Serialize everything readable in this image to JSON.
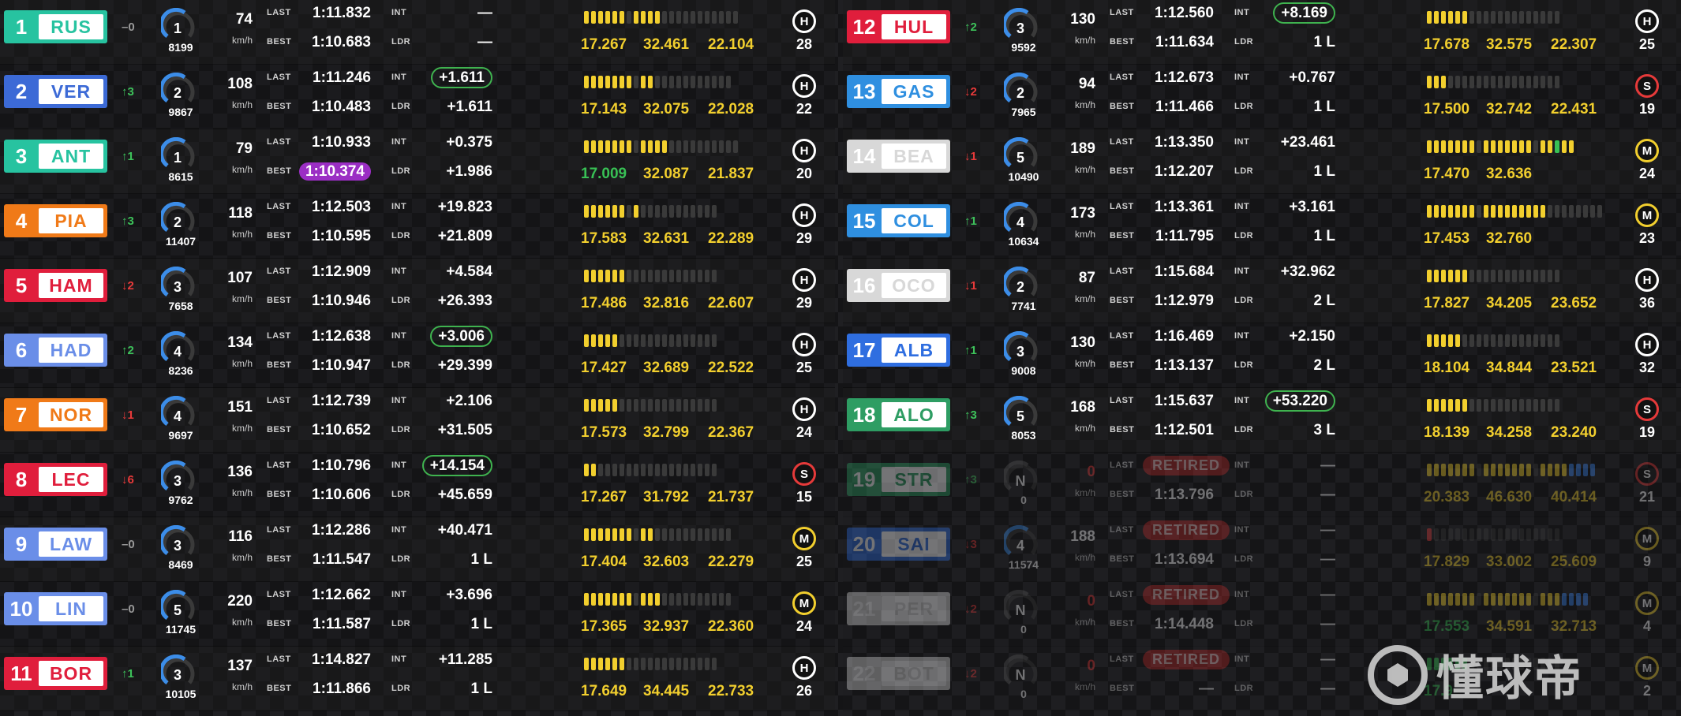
{
  "labels": {
    "last": "LAST",
    "best": "BEST",
    "int": "INT",
    "ldr": "LDR",
    "kmh": "km/h"
  },
  "watermark": "懂球帝",
  "left": [
    {
      "pos": "1",
      "code": "RUS",
      "team_color": "#27c3a0",
      "chg": "0",
      "dir": "none",
      "gear": "1",
      "rpm": "8199",
      "speed": "74",
      "last": "1:11.832",
      "best": "1:10.683",
      "best_style": "",
      "int": "—",
      "ldr": "—",
      "int_style": "",
      "s1": "17.267",
      "s2": "32.461",
      "s3": "22.104",
      "s1c": "y",
      "s2c": "y",
      "s3c": "y",
      "segs": "yyyyyy-yyyy-----------",
      "tyre": "H",
      "laps": "28",
      "dim": false
    },
    {
      "pos": "2",
      "code": "VER",
      "team_color": "#3c6ad6",
      "chg": "3",
      "dir": "up",
      "gear": "2",
      "rpm": "9867",
      "speed": "108",
      "last": "1:11.246",
      "best": "1:10.483",
      "best_style": "",
      "int": "+1.611",
      "ldr": "+1.611",
      "int_style": "green",
      "s1": "17.143",
      "s2": "32.075",
      "s3": "22.028",
      "s1c": "y",
      "s2c": "y",
      "s3c": "y",
      "segs": "yyyyyyy-yy-----------",
      "tyre": "H",
      "laps": "22",
      "dim": false
    },
    {
      "pos": "3",
      "code": "ANT",
      "team_color": "#27c3a0",
      "chg": "1",
      "dir": "up",
      "gear": "1",
      "rpm": "8615",
      "speed": "79",
      "last": "1:10.933",
      "best": "1:10.374",
      "best_style": "purple",
      "int": "+0.375",
      "ldr": "+1.986",
      "int_style": "",
      "s1": "17.009",
      "s2": "32.087",
      "s3": "21.837",
      "s1c": "g",
      "s2c": "y",
      "s3c": "y",
      "segs": "yyyyyyy-yyyy----------",
      "tyre": "H",
      "laps": "20",
      "dim": false
    },
    {
      "pos": "4",
      "code": "PIA",
      "team_color": "#f07a18",
      "chg": "3",
      "dir": "up",
      "gear": "2",
      "rpm": "11407",
      "speed": "118",
      "last": "1:12.503",
      "best": "1:10.595",
      "best_style": "",
      "int": "+19.823",
      "ldr": "+21.809",
      "int_style": "",
      "s1": "17.583",
      "s2": "32.631",
      "s3": "22.289",
      "s1c": "y",
      "s2c": "y",
      "s3c": "y",
      "segs": "yyyyyy-y-----------",
      "tyre": "H",
      "laps": "29",
      "dim": false
    },
    {
      "pos": "5",
      "code": "HAM",
      "team_color": "#e01e3c",
      "chg": "2",
      "dir": "down",
      "gear": "3",
      "rpm": "7658",
      "speed": "107",
      "last": "1:12.909",
      "best": "1:10.946",
      "best_style": "",
      "int": "+4.584",
      "ldr": "+26.393",
      "int_style": "",
      "s1": "17.486",
      "s2": "32.816",
      "s3": "22.607",
      "s1c": "y",
      "s2c": "y",
      "s3c": "y",
      "segs": "yyyyyy-------------",
      "tyre": "H",
      "laps": "29",
      "dim": false
    },
    {
      "pos": "6",
      "code": "HAD",
      "team_color": "#6a8ee8",
      "chg": "2",
      "dir": "up",
      "gear": "4",
      "rpm": "8236",
      "speed": "134",
      "last": "1:12.638",
      "best": "1:10.947",
      "best_style": "",
      "int": "+3.006",
      "ldr": "+29.399",
      "int_style": "green",
      "s1": "17.427",
      "s2": "32.689",
      "s3": "22.522",
      "s1c": "y",
      "s2c": "y",
      "s3c": "y",
      "segs": "yyyyy--------------",
      "tyre": "H",
      "laps": "25",
      "dim": false
    },
    {
      "pos": "7",
      "code": "NOR",
      "team_color": "#f07a18",
      "chg": "1",
      "dir": "down",
      "gear": "4",
      "rpm": "9697",
      "speed": "151",
      "last": "1:12.739",
      "best": "1:10.652",
      "best_style": "",
      "int": "+2.106",
      "ldr": "+31.505",
      "int_style": "",
      "s1": "17.573",
      "s2": "32.799",
      "s3": "22.367",
      "s1c": "y",
      "s2c": "y",
      "s3c": "y",
      "segs": "yyyyy--------------",
      "tyre": "H",
      "laps": "24",
      "dim": false
    },
    {
      "pos": "8",
      "code": "LEC",
      "team_color": "#e01e3c",
      "chg": "6",
      "dir": "down",
      "gear": "3",
      "rpm": "9762",
      "speed": "136",
      "last": "1:10.796",
      "best": "1:10.606",
      "best_style": "",
      "int": "+14.154",
      "ldr": "+45.659",
      "int_style": "green",
      "s1": "17.267",
      "s2": "31.792",
      "s3": "21.737",
      "s1c": "y",
      "s2c": "y",
      "s3c": "y",
      "segs": "yy-----------------",
      "tyre": "S",
      "laps": "15",
      "dim": false
    },
    {
      "pos": "9",
      "code": "LAW",
      "team_color": "#6a8ee8",
      "chg": "0",
      "dir": "none",
      "gear": "3",
      "rpm": "8469",
      "speed": "116",
      "last": "1:12.286",
      "best": "1:11.547",
      "best_style": "",
      "int": "+40.471",
      "ldr": "1 L",
      "int_style": "",
      "s1": "17.404",
      "s2": "32.603",
      "s3": "22.279",
      "s1c": "y",
      "s2c": "y",
      "s3c": "y",
      "segs": "yyyyyyy-yy-----------",
      "tyre": "M",
      "laps": "25",
      "dim": false
    },
    {
      "pos": "10",
      "code": "LIN",
      "team_color": "#6a8ee8",
      "chg": "0",
      "dir": "none",
      "gear": "5",
      "rpm": "11745",
      "speed": "220",
      "last": "1:12.662",
      "best": "1:11.587",
      "best_style": "",
      "int": "+3.696",
      "ldr": "1 L",
      "int_style": "",
      "s1": "17.365",
      "s2": "32.937",
      "s3": "22.360",
      "s1c": "y",
      "s2c": "y",
      "s3c": "y",
      "segs": "yyyyyyy-yyy----------",
      "tyre": "M",
      "laps": "24",
      "dim": false
    },
    {
      "pos": "11",
      "code": "BOR",
      "team_color": "#e01e3c",
      "chg": "1",
      "dir": "up",
      "gear": "3",
      "rpm": "10105",
      "speed": "137",
      "last": "1:14.827",
      "best": "1:11.866",
      "best_style": "",
      "int": "+11.285",
      "ldr": "1 L",
      "int_style": "",
      "s1": "17.649",
      "s2": "34.445",
      "s3": "22.733",
      "s1c": "y",
      "s2c": "y",
      "s3c": "y",
      "segs": "yyyyyy-------------",
      "tyre": "H",
      "laps": "26",
      "dim": false
    }
  ],
  "right": [
    {
      "pos": "12",
      "code": "HUL",
      "team_color": "#e01e3c",
      "chg": "2",
      "dir": "up",
      "gear": "3",
      "rpm": "9592",
      "speed": "130",
      "last": "1:12.560",
      "best": "1:11.634",
      "best_style": "",
      "int": "+8.169",
      "ldr": "1 L",
      "int_style": "green",
      "s1": "17.678",
      "s2": "32.575",
      "s3": "22.307",
      "s1c": "y",
      "s2c": "y",
      "s3c": "y",
      "segs": "yyyyyy-------------",
      "tyre": "H",
      "laps": "25",
      "dim": false
    },
    {
      "pos": "13",
      "code": "GAS",
      "team_color": "#2f8fe0",
      "chg": "2",
      "dir": "down",
      "gear": "2",
      "rpm": "7965",
      "speed": "94",
      "last": "1:12.673",
      "best": "1:11.466",
      "best_style": "",
      "int": "+0.767",
      "ldr": "1 L",
      "int_style": "",
      "s1": "17.500",
      "s2": "32.742",
      "s3": "22.431",
      "s1c": "y",
      "s2c": "y",
      "s3c": "y",
      "segs": "yyy----------------",
      "tyre": "S",
      "laps": "19",
      "dim": false
    },
    {
      "pos": "14",
      "code": "BEA",
      "team_color": "#d8d8d8",
      "chg": "1",
      "dir": "down",
      "gear": "5",
      "rpm": "10490",
      "speed": "189",
      "last": "1:13.350",
      "best": "1:12.207",
      "best_style": "",
      "int": "+23.461",
      "ldr": "1 L",
      "int_style": "",
      "s1": "17.470",
      "s2": "32.636",
      "s3": "",
      "s1c": "y",
      "s2c": "y",
      "s3c": "y",
      "segs": "yyyyyyy-yyyyyyy-yygyy",
      "tyre": "M",
      "laps": "24",
      "dim": false
    },
    {
      "pos": "15",
      "code": "COL",
      "team_color": "#2f8fe0",
      "chg": "1",
      "dir": "up",
      "gear": "4",
      "rpm": "10634",
      "speed": "173",
      "last": "1:13.361",
      "best": "1:11.795",
      "best_style": "",
      "int": "+3.161",
      "ldr": "1 L",
      "int_style": "",
      "s1": "17.453",
      "s2": "32.760",
      "s3": "",
      "s1c": "y",
      "s2c": "y",
      "s3c": "y",
      "segs": "yyyyyyy-yyyyyyyyy--------",
      "tyre": "M",
      "laps": "23",
      "dim": false
    },
    {
      "pos": "16",
      "code": "OCO",
      "team_color": "#d8d8d8",
      "chg": "1",
      "dir": "down",
      "gear": "2",
      "rpm": "7741",
      "speed": "87",
      "last": "1:15.684",
      "best": "1:12.979",
      "best_style": "",
      "int": "+32.962",
      "ldr": "2 L",
      "int_style": "",
      "s1": "17.827",
      "s2": "34.205",
      "s3": "23.652",
      "s1c": "y",
      "s2c": "y",
      "s3c": "y",
      "segs": "yyyyyy-------------",
      "tyre": "H",
      "laps": "36",
      "dim": false
    },
    {
      "pos": "17",
      "code": "ALB",
      "team_color": "#2f6ee0",
      "chg": "1",
      "dir": "up",
      "gear": "3",
      "rpm": "9008",
      "speed": "130",
      "last": "1:16.469",
      "best": "1:13.137",
      "best_style": "",
      "int": "+2.150",
      "ldr": "2 L",
      "int_style": "",
      "s1": "18.104",
      "s2": "34.844",
      "s3": "23.521",
      "s1c": "y",
      "s2c": "y",
      "s3c": "y",
      "segs": "yyyyy--------------",
      "tyre": "H",
      "laps": "32",
      "dim": false
    },
    {
      "pos": "18",
      "code": "ALO",
      "team_color": "#2e9d63",
      "chg": "3",
      "dir": "up",
      "gear": "5",
      "rpm": "8053",
      "speed": "168",
      "last": "1:15.637",
      "best": "1:12.501",
      "best_style": "",
      "int": "+53.220",
      "ldr": "3 L",
      "int_style": "green",
      "s1": "18.139",
      "s2": "34.258",
      "s3": "23.240",
      "s1c": "y",
      "s2c": "y",
      "s3c": "y",
      "segs": "yyyyyy-------------",
      "tyre": "S",
      "laps": "19",
      "dim": false
    },
    {
      "pos": "19",
      "code": "STR",
      "team_color": "#2e9d63",
      "chg": "3",
      "dir": "up",
      "gear": "N",
      "rpm": "0",
      "speed": "0",
      "last": "RETIRED",
      "best": "1:13.796",
      "best_style": "",
      "int": "—",
      "ldr": "—",
      "int_style": "",
      "s1": "20.383",
      "s2": "46.630",
      "s3": "40.414",
      "s1c": "y",
      "s2c": "y",
      "s3c": "y",
      "segs": "yyyyyyy-yyyyyyy-yyyybbbb",
      "tyre": "S",
      "laps": "21",
      "dim": true
    },
    {
      "pos": "20",
      "code": "SAI",
      "team_color": "#2f6ee0",
      "chg": "3",
      "dir": "down",
      "gear": "4",
      "rpm": "11574",
      "speed": "188",
      "last": "RETIRED",
      "best": "1:13.694",
      "best_style": "",
      "int": "—",
      "ldr": "—",
      "int_style": "",
      "s1": "17.829",
      "s2": "33.002",
      "s3": "25.609",
      "s1c": "y",
      "s2c": "y",
      "s3c": "y",
      "segs": "r------------------",
      "tyre": "M",
      "laps": "9",
      "dim": true
    },
    {
      "pos": "21",
      "code": "PER",
      "team_color": "#d8d8d8",
      "chg": "2",
      "dir": "down",
      "gear": "N",
      "rpm": "0",
      "speed": "0",
      "last": "RETIRED",
      "best": "1:14.448",
      "best_style": "",
      "int": "—",
      "ldr": "—",
      "int_style": "",
      "s1": "17.553",
      "s2": "34.591",
      "s3": "32.713",
      "s1c": "g",
      "s2c": "y",
      "s3c": "y",
      "segs": "yyyyyyy-yyyyyyy-yyybbbb",
      "tyre": "M",
      "laps": "4",
      "dim": true
    },
    {
      "pos": "22",
      "code": "BOT",
      "team_color": "#d8d8d8",
      "chg": "2",
      "dir": "down",
      "gear": "N",
      "rpm": "0",
      "speed": "0",
      "last": "RETIRED",
      "best": "—",
      "best_style": "",
      "int": "—",
      "ldr": "—",
      "int_style": "",
      "s1": "17.9",
      "s2": "",
      "s3": "",
      "s1c": "g",
      "s2c": "y",
      "s3c": "y",
      "segs": "gggggg-------------",
      "tyre": "M",
      "laps": "2",
      "dim": true
    }
  ]
}
